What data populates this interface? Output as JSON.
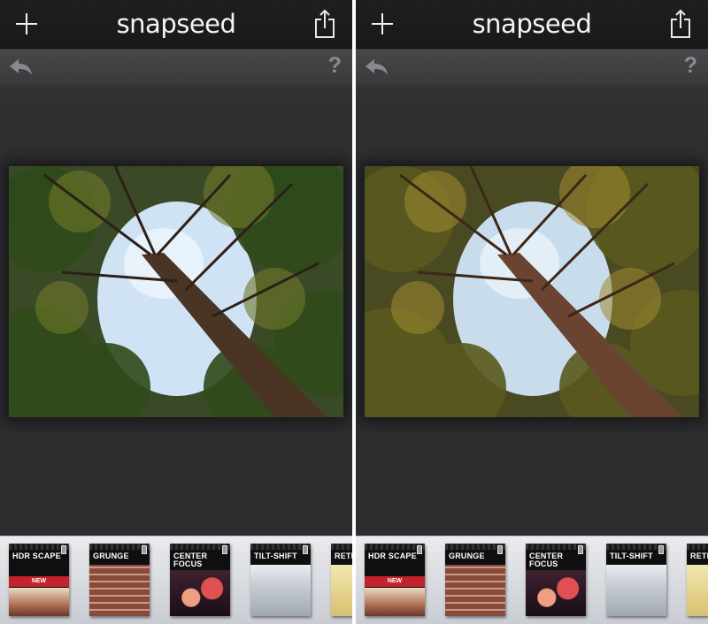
{
  "app": {
    "logo_text": "snapseed"
  },
  "toolbar": {
    "add_icon": "plus-icon",
    "share_icon": "share-icon"
  },
  "edit_bar": {
    "undo_icon": "undo-arrow-icon",
    "help_label": "?"
  },
  "filters": [
    {
      "label": "HDR SCAPE",
      "badge": "NEW"
    },
    {
      "label": "GRUNGE"
    },
    {
      "label": "CENTER FOCUS"
    },
    {
      "label": "TILT-SHIFT"
    },
    {
      "label": "RETRO"
    }
  ],
  "photo": {
    "subject": "tree canopy seen from below"
  },
  "colors": {
    "badge_red": "#c4222c",
    "topbar": "#1c1c1e",
    "tray": "#dfe1e5"
  }
}
